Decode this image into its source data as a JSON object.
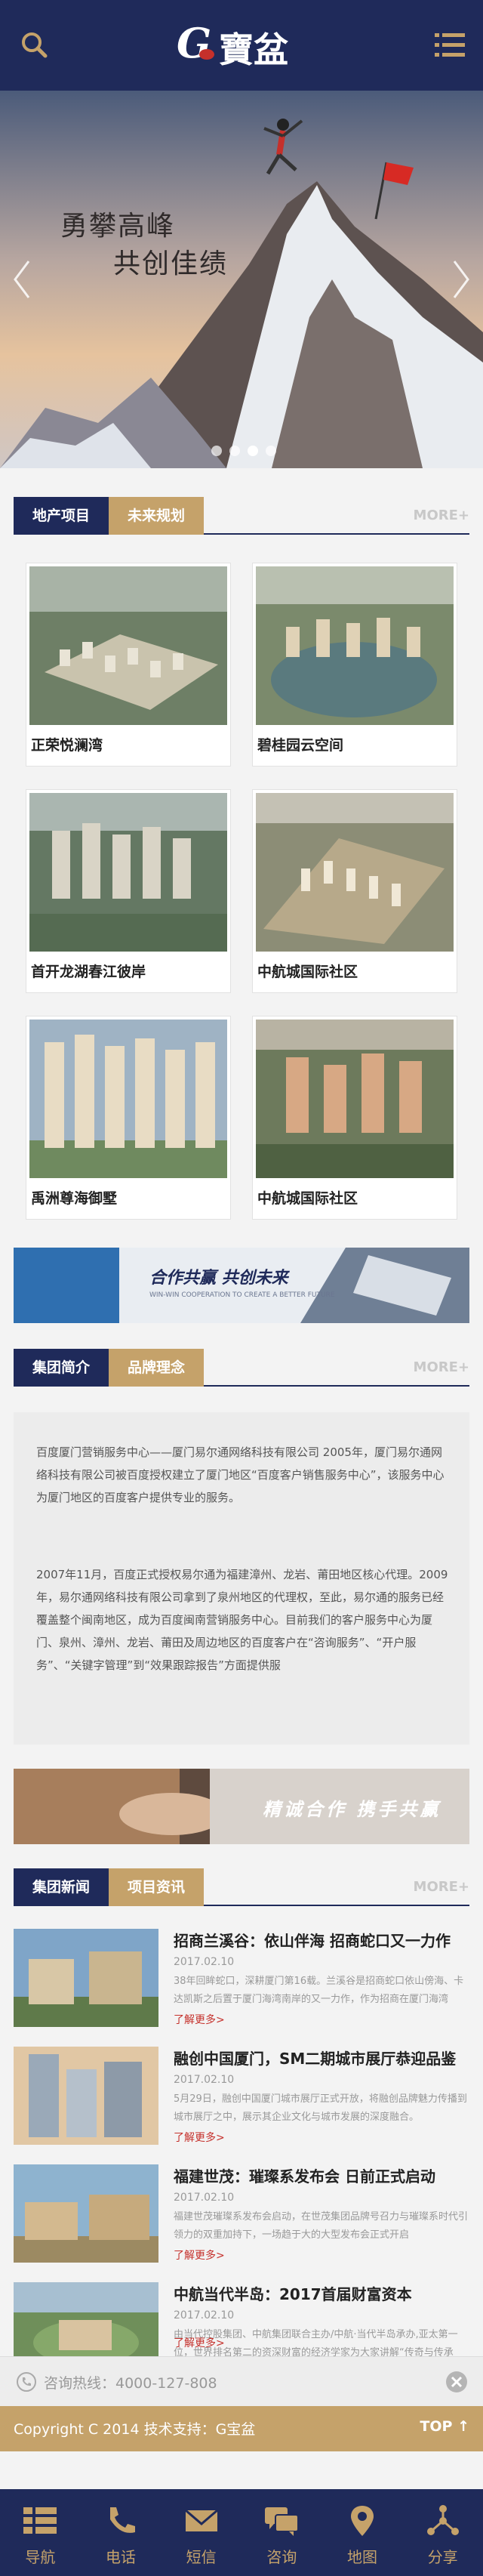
{
  "header": {
    "logo_text": "G寶盆",
    "search_icon": "search-icon",
    "menu_icon": "menu-icon"
  },
  "banner": {
    "slogan_line1": "勇攀高峰",
    "slogan_line2": "共创佳绩",
    "slide_count": 4,
    "active_slide": 2
  },
  "section_projects": {
    "tab1": "地产项目",
    "tab2": "未来规划",
    "more": "MORE+"
  },
  "projects": [
    {
      "name": "正荣悦澜湾"
    },
    {
      "name": "碧桂园云空间"
    },
    {
      "name": "首开龙湖春江彼岸"
    },
    {
      "name": "中航城国际社区"
    },
    {
      "name": "禹洲尊海御墅"
    },
    {
      "name": "中航城国际社区"
    }
  ],
  "ad1": {
    "text": "合作共赢 共创未来",
    "sub": "WIN-WIN COOPERATION TO CREATE A BETTER FUTURE"
  },
  "section_intro": {
    "tab1": "集团简介",
    "tab2": "品牌理念",
    "more": "MORE+"
  },
  "intro": {
    "para1": "百度厦门营销服务中心——厦门易尔通网络科技有限公司 2005年，厦门易尔通网络科技有限公司被百度授权建立了厦门地区“百度客户销售服务中心”，该服务中心为厦门地区的百度客户提供专业的服务。",
    "para2": "2007年11月，百度正式授权易尔通为福建漳州、龙岩、莆田地区核心代理。2009年，易尔通网络科技有限公司拿到了泉州地区的代理权，至此，易尔通的服务已经覆盖整个闽南地区，成为百度闽南营销服务中心。目前我们的客户服务中心为厦门、泉州、漳州、龙岩、莆田及周边地区的百度客户在“咨询服务”、“开户服务”、“关键字管理”到“效果跟踪报告”方面提供服"
  },
  "ad2": {
    "text": "精诚合作 携手共赢"
  },
  "section_news": {
    "tab1": "集团新闻",
    "tab2": "项目资讯",
    "more": "MORE+"
  },
  "news": [
    {
      "title": "招商兰溪谷：依山伴海 招商蛇口又一力作",
      "date": "2017.02.10",
      "desc": "38年回眸蛇口，深耕厦门第16载。兰溪谷是招商蛇口依山傍海、卡达凯斯之后置于厦门海湾南岸的又一力作，作为招商在厦门海湾",
      "more": "了解更多>"
    },
    {
      "title": "融创中国厦门，SM二期城市展厅恭迎品鉴",
      "date": "2017.02.10",
      "desc": "5月29日，融创中国厦门城市展厅正式开放，将融创品牌魅力传播到城市展厅之中，展示其企业文化与城市发展的深度融合。",
      "more": "了解更多>"
    },
    {
      "title": "福建世茂：璀璨系发布会 日前正式启动",
      "date": "2017.02.10",
      "desc": "福建世茂璀璨系发布会启动，在世茂集团品牌号召力与璀璨系时代引领力的双重加持下，一场趋于大的大型发布会正式开启",
      "more": "了解更多>"
    },
    {
      "title": "中航当代半岛：2017首届财富资本",
      "date": "2017.02.10",
      "desc": "由当代控股集团、中航集团联合主办/中航·当代半岛承办,亚太第一位，世界排名第二的资深财富的经济学家为大家讲解“传奇与传承",
      "more": "了解更多>"
    }
  ],
  "hotline": {
    "text": "咨询热线：4000-127-808"
  },
  "copyright": {
    "text": "Copyright C 2014 技术支持：G宝盆",
    "top_label": "TOP"
  },
  "bottom_nav": [
    {
      "label": "导航",
      "icon": "grid-list-icon"
    },
    {
      "label": "电话",
      "icon": "phone-icon"
    },
    {
      "label": "短信",
      "icon": "envelope-icon"
    },
    {
      "label": "咨询",
      "icon": "chat-icon"
    },
    {
      "label": "地图",
      "icon": "map-pin-icon"
    },
    {
      "label": "分享",
      "icon": "share-icon"
    }
  ],
  "colors": {
    "navy": "#1f2a5a",
    "gold": "#c5a26a",
    "link_red": "#c5302b"
  }
}
